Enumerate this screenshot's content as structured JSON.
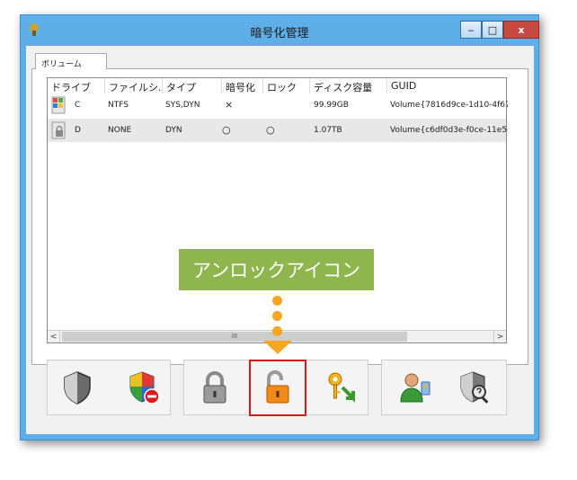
{
  "window": {
    "title": "暗号化管理",
    "min_label": "‒",
    "max_label": "□",
    "close_label": "x"
  },
  "tab": {
    "label": "ボリューム"
  },
  "list": {
    "columns": [
      "ドライブ",
      "ファイルシ...",
      "タイプ",
      "暗号化",
      "ロック",
      "ディスク容量",
      "GUID"
    ],
    "rows": [
      {
        "drive": "C",
        "fs": "NTFS",
        "type": "SYS,DYN",
        "encrypted": "×",
        "lock": "",
        "size": "99.99GB",
        "guid": "Volume{7816d9ce-1d10-4f67-"
      },
      {
        "drive": "D",
        "fs": "NONE",
        "type": "DYN",
        "encrypted": "○",
        "lock": "○",
        "size": "1.07TB",
        "guid": "Volume{c6df0d3e-f0ce-11e5-"
      }
    ],
    "scroll_left": "<",
    "scroll_right": ">",
    "scroll_thumb": "III"
  },
  "annotation": {
    "label": "アンロックアイコン",
    "color": "#8fb54f",
    "arrow_color": "#f5a623"
  },
  "toolbar": {
    "icons": [
      "shield-icon",
      "shield-remove-icon",
      "lock-icon",
      "unlock-icon",
      "key-import-icon",
      "user-key-icon",
      "shield-search-icon"
    ]
  }
}
